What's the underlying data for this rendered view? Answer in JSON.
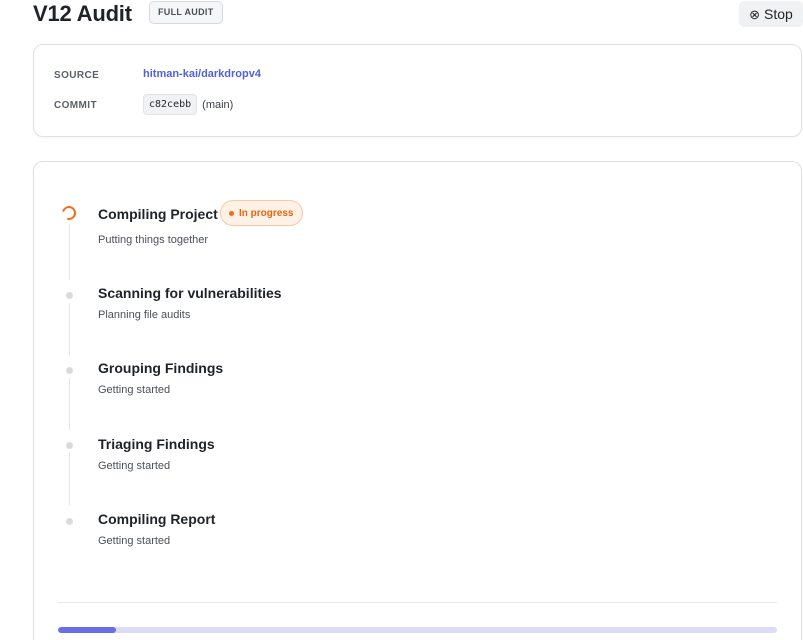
{
  "header": {
    "title": "V12 Audit",
    "badge": "FULL AUDIT",
    "stop_label": "Stop",
    "stop_icon": "circle-x-icon"
  },
  "source_card": {
    "source_label": "SOURCE",
    "source_value": "hitman-kai/darkdropv4",
    "commit_label": "COMMIT",
    "commit_hash": "c82cebb",
    "commit_branch": "(main)"
  },
  "steps": [
    {
      "title": "Compiling Project",
      "subtitle": "Putting things together",
      "state": "in-progress",
      "status_label": "In progress"
    },
    {
      "title": "Scanning for vulnerabilities",
      "subtitle": "Planning file audits",
      "state": "pending"
    },
    {
      "title": "Grouping Findings",
      "subtitle": "Getting started",
      "state": "pending"
    },
    {
      "title": "Triaging Findings",
      "subtitle": "Getting started",
      "state": "pending"
    },
    {
      "title": "Compiling Report",
      "subtitle": "Getting started",
      "state": "pending"
    }
  ],
  "progress": {
    "fraction": 0.08
  },
  "colors": {
    "accent": "#6a6ce8",
    "in_progress": "#f26b1d",
    "link": "#5560d6"
  }
}
